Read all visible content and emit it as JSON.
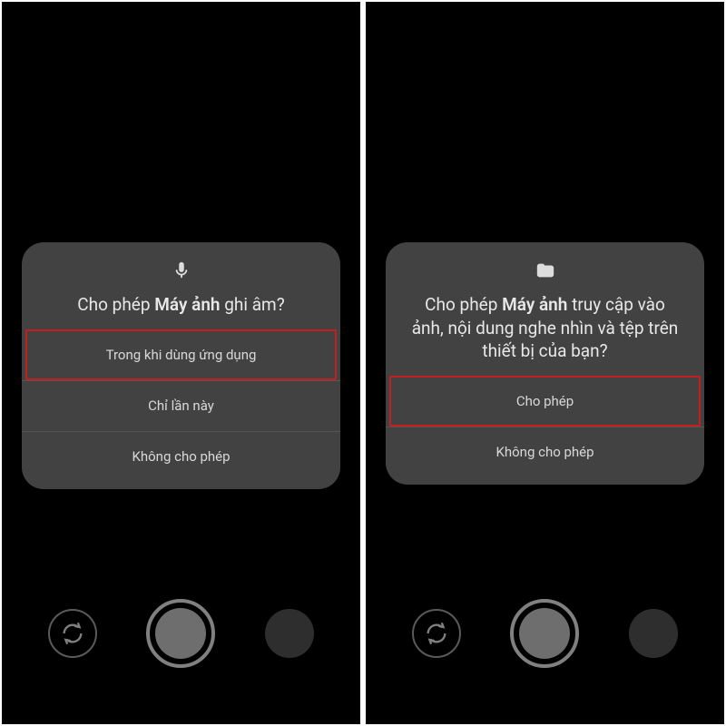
{
  "screens": [
    {
      "icon": "microphone",
      "title_pre": "Cho phép ",
      "title_bold": "Máy ảnh",
      "title_post": " ghi âm?",
      "buttons": [
        {
          "label": "Trong khi dùng ứng dụng",
          "highlighted": true
        },
        {
          "label": "Chỉ lần này",
          "highlighted": false
        },
        {
          "label": "Không cho phép",
          "highlighted": false
        }
      ]
    },
    {
      "icon": "folder",
      "title_pre": "Cho phép ",
      "title_bold": "Máy ảnh",
      "title_post": " truy cập vào ảnh, nội dung nghe nhìn và tệp trên thiết bị của bạn?",
      "buttons": [
        {
          "label": "Cho phép",
          "highlighted": true
        },
        {
          "label": "Không cho phép",
          "highlighted": false
        }
      ]
    }
  ]
}
